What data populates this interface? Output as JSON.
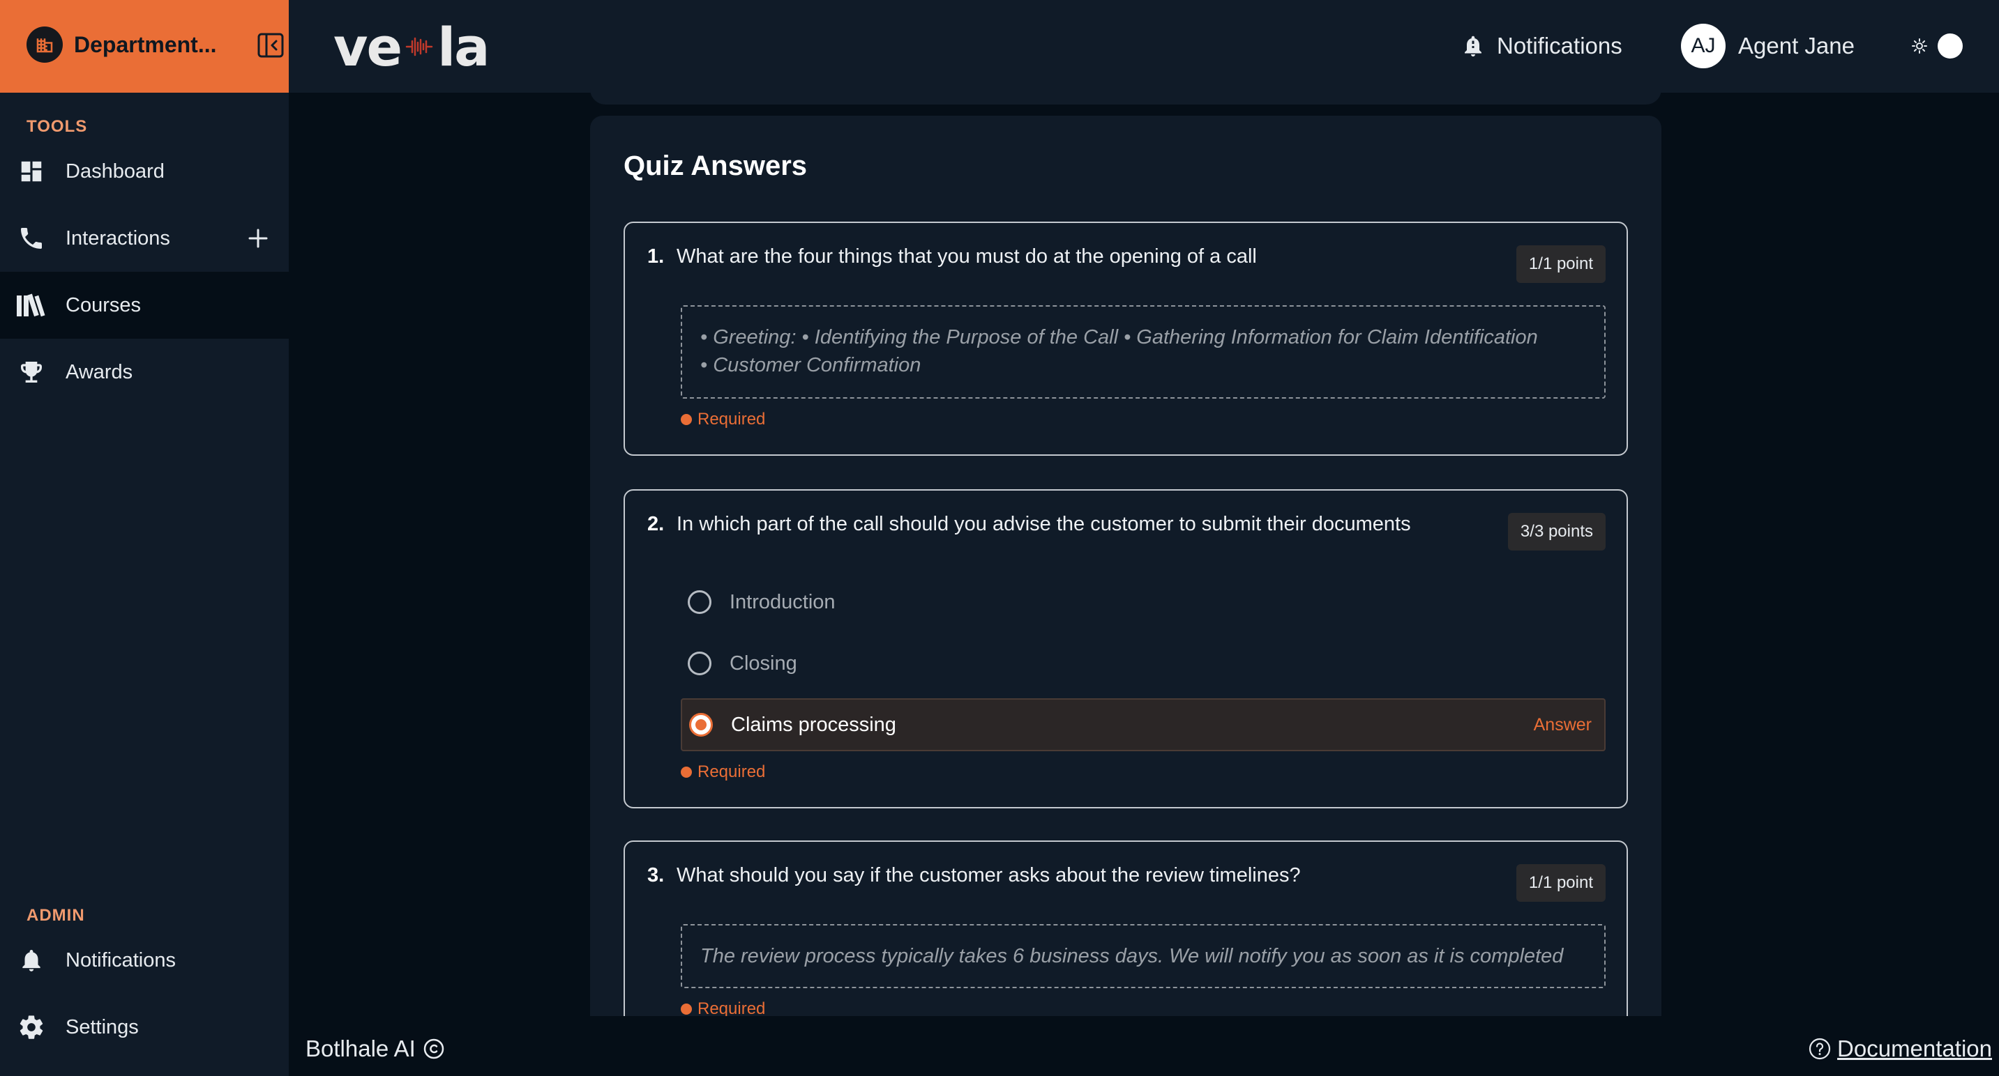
{
  "sidebar": {
    "department_name": "Department...",
    "tools_label": "TOOLS",
    "admin_label": "ADMIN",
    "tools_items": [
      {
        "label": "Dashboard",
        "icon": "dashboard-icon"
      },
      {
        "label": "Interactions",
        "icon": "phone-icon"
      },
      {
        "label": "Courses",
        "icon": "books-icon",
        "active": true
      },
      {
        "label": "Awards",
        "icon": "trophy-icon"
      }
    ],
    "admin_items": [
      {
        "label": "Notifications",
        "icon": "bell-icon"
      },
      {
        "label": "Settings",
        "icon": "gear-icon"
      }
    ]
  },
  "topbar": {
    "brand_left": "ve",
    "brand_right": "la",
    "notifications_label": "Notifications",
    "user_initials": "AJ",
    "user_name": "Agent Jane"
  },
  "quiz": {
    "title": "Quiz Answers",
    "questions": [
      {
        "number": "1.",
        "text": "What are the four things that you must do at the opening of a call",
        "points": "1/1 point",
        "answer_lines": [
          "• Greeting: • Identifying the Purpose of the Call • Gathering Information for Claim Identification",
          "• Customer Confirmation"
        ],
        "required": "Required"
      },
      {
        "number": "2.",
        "text": "In which part of the call should you advise the customer to submit their documents",
        "points": "3/3 points",
        "options": [
          {
            "label": "Introduction",
            "selected": false
          },
          {
            "label": "Closing",
            "selected": false
          },
          {
            "label": "Claims processing",
            "selected": true
          }
        ],
        "answer_tag": "Answer",
        "required": "Required"
      },
      {
        "number": "3.",
        "text": "What should you say if the customer asks about the review timelines?",
        "points": "1/1 point",
        "answer_lines": [
          "The review process typically takes 6 business days. We will notify you as soon as it is completed"
        ],
        "required": "Required"
      }
    ]
  },
  "footer": {
    "company": "Botlhale AI",
    "documentation": "Documentation"
  },
  "colors": {
    "accent": "#ea6e36",
    "sidebar_bg": "#101b28",
    "page_bg": "#050e17",
    "card_bg": "#101b28"
  }
}
